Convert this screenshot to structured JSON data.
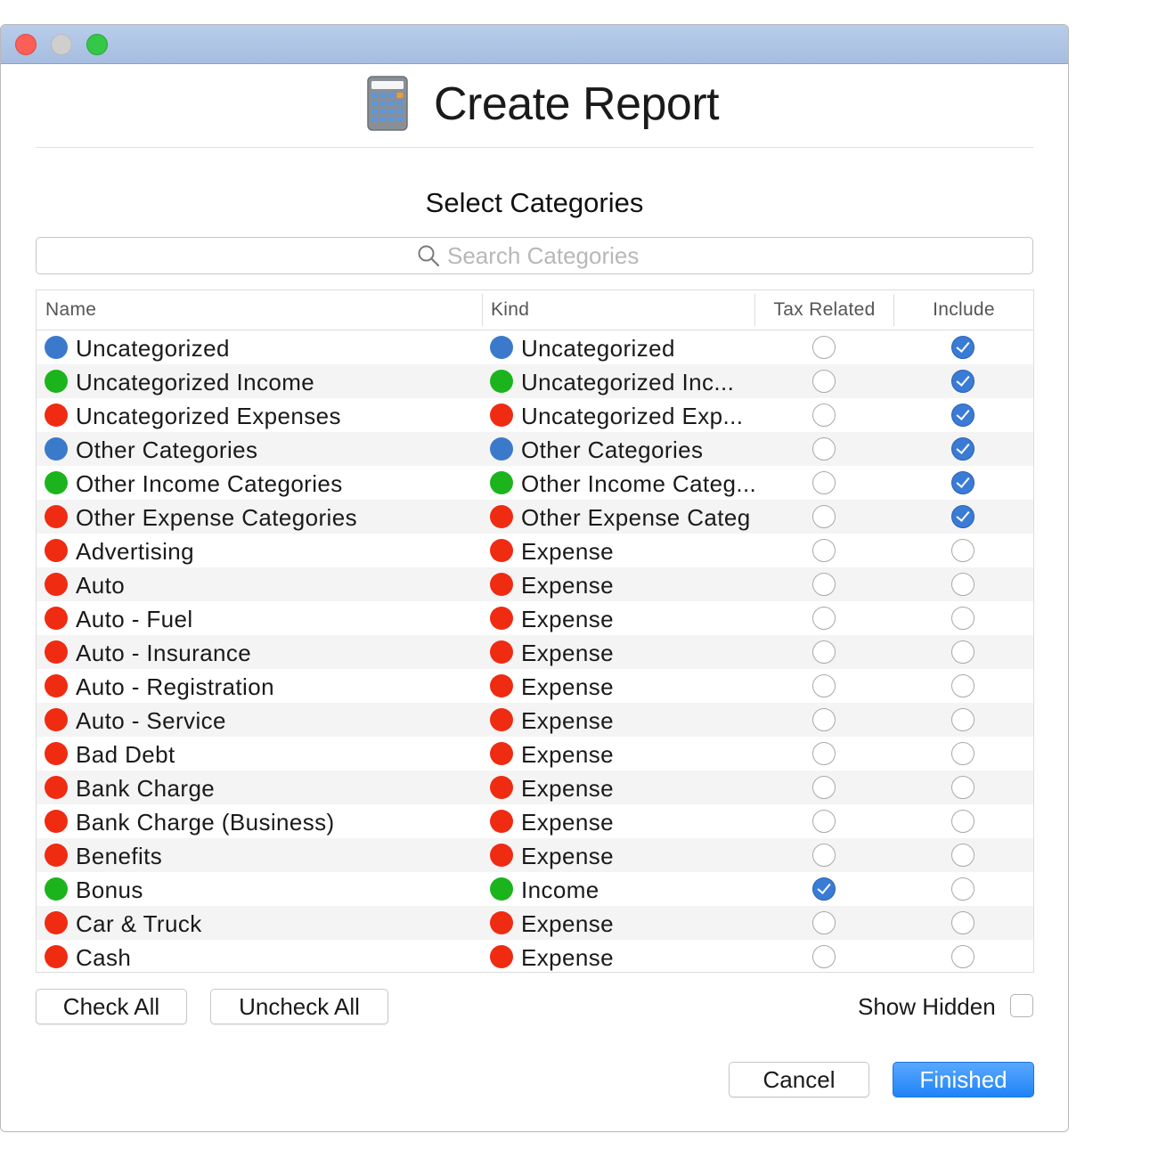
{
  "window": {
    "controls": [
      "close",
      "minimize",
      "zoom"
    ]
  },
  "header": {
    "icon": "calculator-icon",
    "title": "Create Report"
  },
  "section_title": "Select Categories",
  "search": {
    "placeholder": "Search Categories",
    "value": ""
  },
  "table": {
    "columns": {
      "name": "Name",
      "kind": "Kind",
      "tax": "Tax Related",
      "include": "Include"
    },
    "rows": [
      {
        "name": "Uncategorized",
        "name_color": "blue",
        "kind": "Uncategorized",
        "kind_color": "blue",
        "tax": false,
        "include": true
      },
      {
        "name": "Uncategorized Income",
        "name_color": "green",
        "kind": "Uncategorized Inc...",
        "kind_color": "green",
        "tax": false,
        "include": true
      },
      {
        "name": "Uncategorized Expenses",
        "name_color": "red",
        "kind": "Uncategorized Exp...",
        "kind_color": "red",
        "tax": false,
        "include": true
      },
      {
        "name": "Other Categories",
        "name_color": "blue",
        "kind": "Other Categories",
        "kind_color": "blue",
        "tax": false,
        "include": true
      },
      {
        "name": "Other Income Categories",
        "name_color": "green",
        "kind": "Other Income Categ...",
        "kind_color": "green",
        "tax": false,
        "include": true
      },
      {
        "name": "Other Expense Categories",
        "name_color": "red",
        "kind": "Other Expense Categ",
        "kind_color": "red",
        "tax": false,
        "include": true
      },
      {
        "name": "Advertising",
        "name_color": "red",
        "kind": "Expense",
        "kind_color": "red",
        "tax": false,
        "include": false
      },
      {
        "name": "Auto",
        "name_color": "red",
        "kind": "Expense",
        "kind_color": "red",
        "tax": false,
        "include": false
      },
      {
        "name": "Auto - Fuel",
        "name_color": "red",
        "kind": "Expense",
        "kind_color": "red",
        "tax": false,
        "include": false
      },
      {
        "name": "Auto - Insurance",
        "name_color": "red",
        "kind": "Expense",
        "kind_color": "red",
        "tax": false,
        "include": false
      },
      {
        "name": "Auto - Registration",
        "name_color": "red",
        "kind": "Expense",
        "kind_color": "red",
        "tax": false,
        "include": false
      },
      {
        "name": "Auto - Service",
        "name_color": "red",
        "kind": "Expense",
        "kind_color": "red",
        "tax": false,
        "include": false
      },
      {
        "name": "Bad Debt",
        "name_color": "red",
        "kind": "Expense",
        "kind_color": "red",
        "tax": false,
        "include": false
      },
      {
        "name": "Bank Charge",
        "name_color": "red",
        "kind": "Expense",
        "kind_color": "red",
        "tax": false,
        "include": false
      },
      {
        "name": "Bank Charge (Business)",
        "name_color": "red",
        "kind": "Expense",
        "kind_color": "red",
        "tax": false,
        "include": false
      },
      {
        "name": "Benefits",
        "name_color": "red",
        "kind": "Expense",
        "kind_color": "red",
        "tax": false,
        "include": false
      },
      {
        "name": "Bonus",
        "name_color": "green",
        "kind": "Income",
        "kind_color": "green",
        "tax": true,
        "include": false
      },
      {
        "name": "Car & Truck",
        "name_color": "red",
        "kind": "Expense",
        "kind_color": "red",
        "tax": false,
        "include": false
      },
      {
        "name": "Cash",
        "name_color": "red",
        "kind": "Expense",
        "kind_color": "red",
        "tax": false,
        "include": false
      }
    ]
  },
  "colors": {
    "blue": "#3b7acb",
    "green": "#1cb41c",
    "red": "#ef2b12",
    "accent": "#1f84f7"
  },
  "footer": {
    "check_all": "Check All",
    "uncheck_all": "Uncheck All",
    "show_hidden": "Show Hidden",
    "show_hidden_checked": false,
    "cancel": "Cancel",
    "finished": "Finished"
  }
}
